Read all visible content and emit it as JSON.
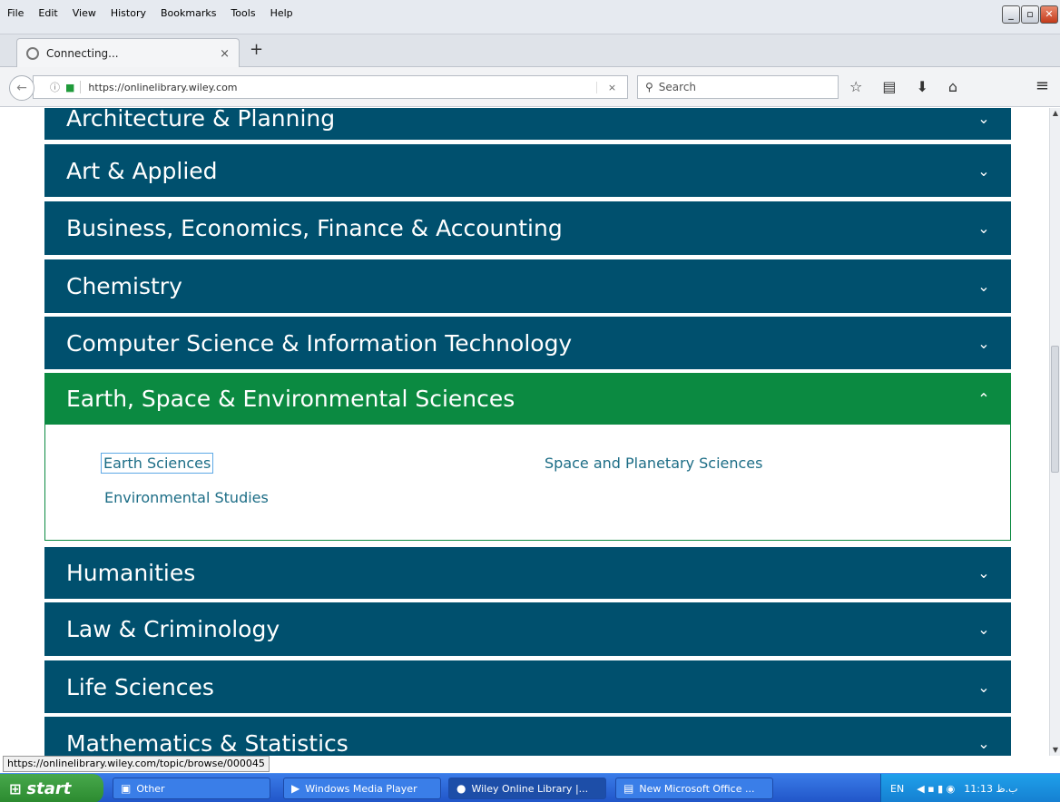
{
  "menubar": {
    "items": [
      "File",
      "Edit",
      "View",
      "History",
      "Bookmarks",
      "Tools",
      "Help"
    ]
  },
  "window": {
    "minimize": "_",
    "restore": "▫",
    "close": "✕"
  },
  "tab": {
    "title": "Connecting...",
    "close": "×",
    "new_tab": "+"
  },
  "nav": {
    "url": "https://onlinelibrary.wiley.com",
    "search_placeholder": "Search"
  },
  "accordion": [
    {
      "label": "Architecture & Planning"
    },
    {
      "label": "Art & Applied"
    },
    {
      "label": "Business, Economics, Finance & Accounting"
    },
    {
      "label": "Chemistry"
    },
    {
      "label": "Computer Science & Information Technology"
    },
    {
      "label": "Earth, Space & Environmental Sciences"
    },
    {
      "label": "Humanities"
    },
    {
      "label": "Law & Criminology"
    },
    {
      "label": "Life Sciences"
    },
    {
      "label": "Mathematics & Statistics"
    }
  ],
  "expanded_panel": {
    "links": [
      "Earth Sciences",
      "Space and Planetary Sciences",
      "Environmental Studies"
    ]
  },
  "status_url": "https://onlinelibrary.wiley.com/topic/browse/000045",
  "taskbar": {
    "start": "start",
    "tasks": [
      "Other",
      "Windows Media Player",
      "Wiley Online Library |...",
      "New Microsoft Office ..."
    ],
    "tray_lang": "EN",
    "tray_time": "11:13 ب.ظ"
  },
  "colors": {
    "accordion_blue": "#00506e",
    "accordion_green": "#0b8a41",
    "link": "#1c6d86"
  }
}
